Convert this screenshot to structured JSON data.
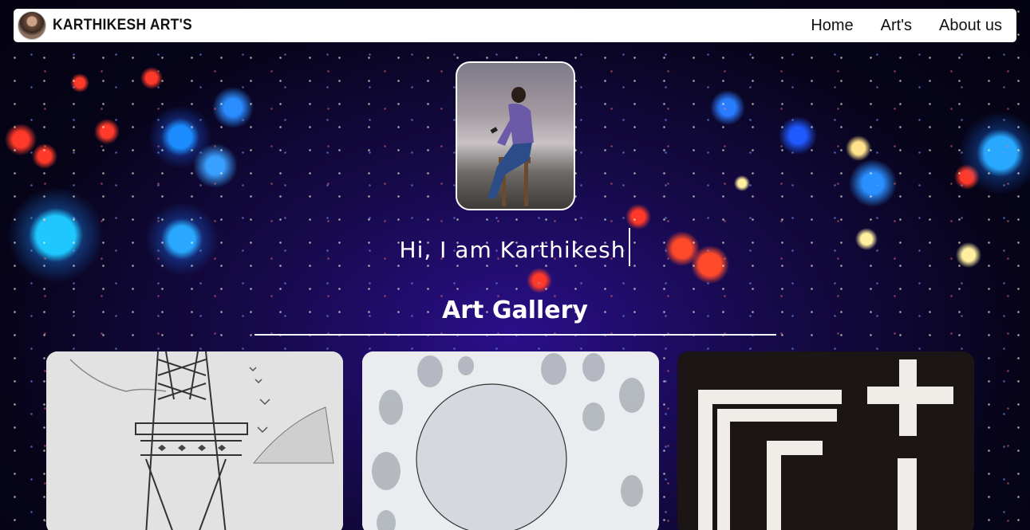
{
  "navbar": {
    "brand_name": "KARTHIKESH ART'S",
    "links": [
      {
        "label": "Home"
      },
      {
        "label": "Art's"
      },
      {
        "label": "About us"
      }
    ]
  },
  "hero": {
    "greeting": "Hi, I am Karthikesh"
  },
  "gallery": {
    "title": "Art Gallery",
    "items": [
      {
        "subject": "eiffel-tower-sketch"
      },
      {
        "subject": "circle-fingerprint-art"
      },
      {
        "subject": "bw-geometric-painting"
      }
    ]
  }
}
